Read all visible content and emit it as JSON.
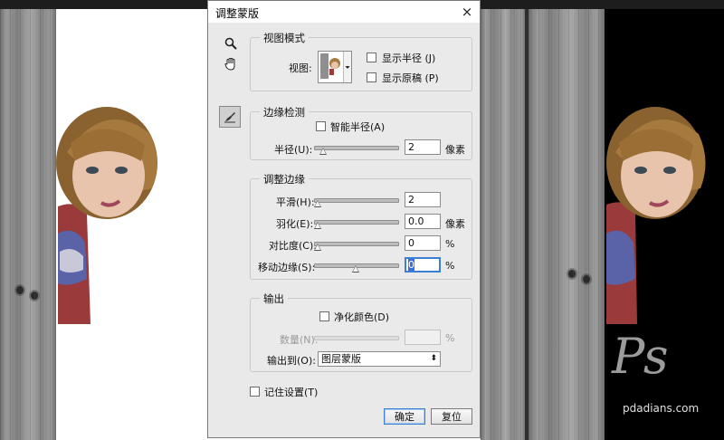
{
  "dialog": {
    "title": "调整蒙版",
    "close_icon": "×",
    "view_mode": {
      "group_title": "视图模式",
      "view_label": "视图:",
      "show_radius_label": "显示半径 (J)",
      "show_original_label": "显示原稿 (P)"
    },
    "edge_detection": {
      "group_title": "边缘检测",
      "smart_radius_label": "智能半径(A)",
      "radius_label": "半径(U):",
      "radius_value": "2",
      "radius_unit": "像素"
    },
    "adjust_edge": {
      "group_title": "调整边缘",
      "smooth_label": "平滑(H):",
      "smooth_value": "2",
      "feather_label": "羽化(E):",
      "feather_value": "0.0",
      "feather_unit": "像素",
      "contrast_label": "对比度(C):",
      "contrast_value": "0",
      "contrast_unit": "%",
      "shift_edge_label": "移动边缘(S):",
      "shift_edge_value": "0",
      "shift_edge_unit": "%"
    },
    "output": {
      "group_title": "输出",
      "decontaminate_label": "净化颜色(D)",
      "amount_label": "数量(N):",
      "amount_unit": "%",
      "output_to_label": "输出到(O):",
      "output_to_value": "图层蒙版"
    },
    "remember_label": "记住设置(T)",
    "ok_label": "确定",
    "reset_label": "复位"
  },
  "watermark": {
    "logo_text": "Ps",
    "url": "pdadians.com"
  },
  "icons": [
    "zoom-icon",
    "hand-icon",
    "refine-radius-brush-icon",
    "close-icon",
    "dropdown-arrow-icon"
  ]
}
